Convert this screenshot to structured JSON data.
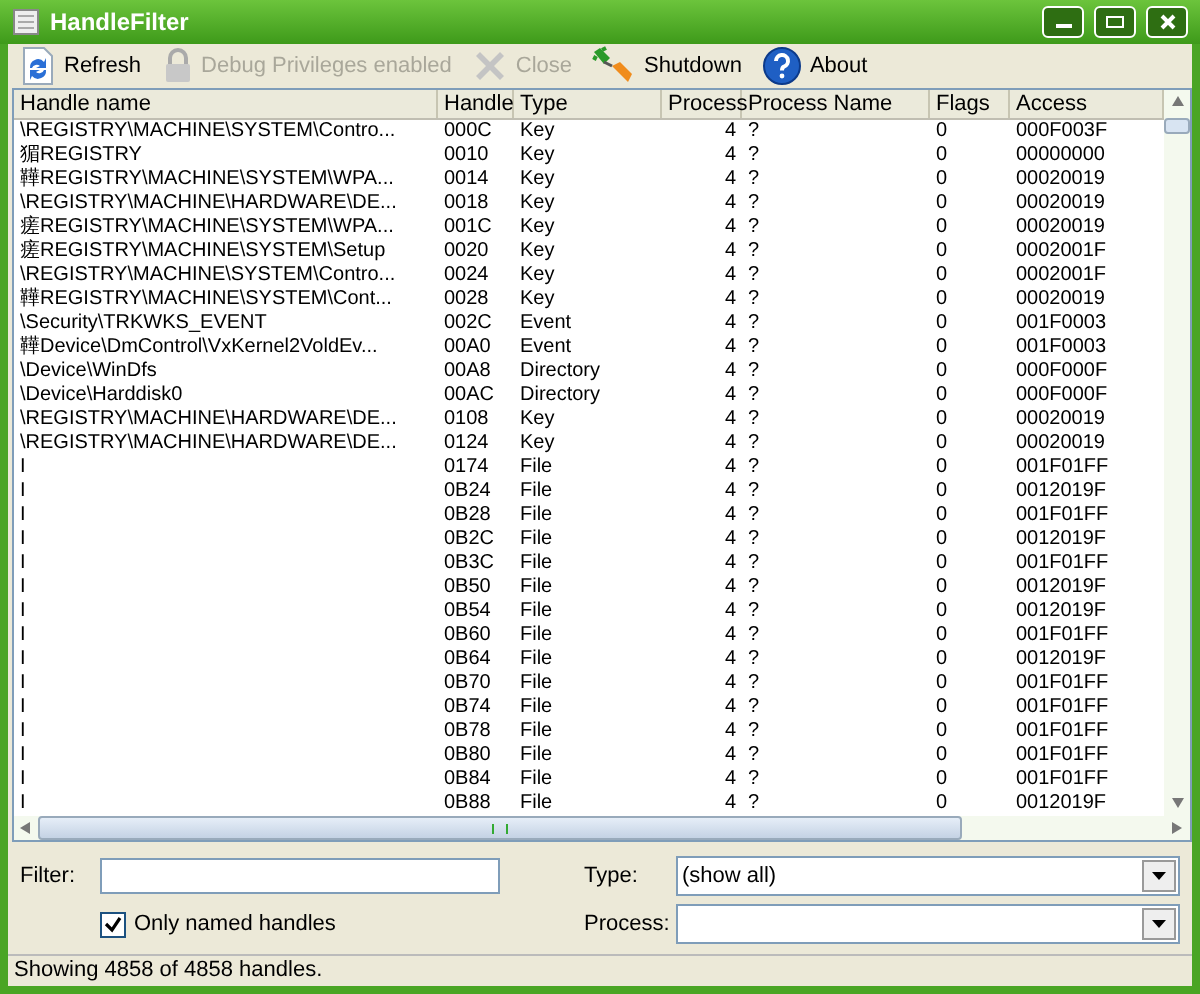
{
  "window": {
    "title": "HandleFilter"
  },
  "toolbar": [
    {
      "kind": "refresh",
      "label": "Refresh",
      "disabled": false
    },
    {
      "kind": "lock",
      "label": "Debug Privileges enabled",
      "disabled": true
    },
    {
      "kind": "close",
      "label": "Close",
      "disabled": true
    },
    {
      "kind": "shutdown",
      "label": "Shutdown",
      "disabled": false
    },
    {
      "kind": "about",
      "label": "About",
      "disabled": false
    }
  ],
  "table": {
    "columns": [
      "Handle name",
      "Handle",
      "Type",
      "Process",
      "Process Name",
      "Flags",
      "Access"
    ],
    "rows": [
      [
        "\\REGISTRY\\MACHINE\\SYSTEM\\Contro...",
        "000C",
        "Key",
        "4",
        "?",
        "0",
        "000F003F"
      ],
      [
        "猸REGISTRY",
        "0010",
        "Key",
        "4",
        "?",
        "0",
        "00000000"
      ],
      [
        "鞾REGISTRY\\MACHINE\\SYSTEM\\WPA...",
        "0014",
        "Key",
        "4",
        "?",
        "0",
        "00020019"
      ],
      [
        "\\REGISTRY\\MACHINE\\HARDWARE\\DE...",
        "0018",
        "Key",
        "4",
        "?",
        "0",
        "00020019"
      ],
      [
        "瘥REGISTRY\\MACHINE\\SYSTEM\\WPA...",
        "001C",
        "Key",
        "4",
        "?",
        "0",
        "00020019"
      ],
      [
        "瘥REGISTRY\\MACHINE\\SYSTEM\\Setup",
        "0020",
        "Key",
        "4",
        "?",
        "0",
        "0002001F"
      ],
      [
        "\\REGISTRY\\MACHINE\\SYSTEM\\Contro...",
        "0024",
        "Key",
        "4",
        "?",
        "0",
        "0002001F"
      ],
      [
        "鞾REGISTRY\\MACHINE\\SYSTEM\\Cont...",
        "0028",
        "Key",
        "4",
        "?",
        "0",
        "00020019"
      ],
      [
        "\\Security\\TRKWKS_EVENT",
        "002C",
        "Event",
        "4",
        "?",
        "0",
        "001F0003"
      ],
      [
        "鞾Device\\DmControl\\VxKernel2VoldEv...",
        "00A0",
        "Event",
        "4",
        "?",
        "0",
        "001F0003"
      ],
      [
        "\\Device\\WinDfs",
        "00A8",
        "Directory",
        "4",
        "?",
        "0",
        "000F000F"
      ],
      [
        "\\Device\\Harddisk0",
        "00AC",
        "Directory",
        "4",
        "?",
        "0",
        "000F000F"
      ],
      [
        "\\REGISTRY\\MACHINE\\HARDWARE\\DE...",
        "0108",
        "Key",
        "4",
        "?",
        "0",
        "00020019"
      ],
      [
        "\\REGISTRY\\MACHINE\\HARDWARE\\DE...",
        "0124",
        "Key",
        "4",
        "?",
        "0",
        "00020019"
      ],
      [
        "I",
        "0174",
        "File",
        "4",
        "?",
        "0",
        "001F01FF"
      ],
      [
        "I",
        "0B24",
        "File",
        "4",
        "?",
        "0",
        "0012019F"
      ],
      [
        "I",
        "0B28",
        "File",
        "4",
        "?",
        "0",
        "001F01FF"
      ],
      [
        "I",
        "0B2C",
        "File",
        "4",
        "?",
        "0",
        "0012019F"
      ],
      [
        "I",
        "0B3C",
        "File",
        "4",
        "?",
        "0",
        "001F01FF"
      ],
      [
        "I",
        "0B50",
        "File",
        "4",
        "?",
        "0",
        "0012019F"
      ],
      [
        "I",
        "0B54",
        "File",
        "4",
        "?",
        "0",
        "0012019F"
      ],
      [
        "I",
        "0B60",
        "File",
        "4",
        "?",
        "0",
        "001F01FF"
      ],
      [
        "I",
        "0B64",
        "File",
        "4",
        "?",
        "0",
        "0012019F"
      ],
      [
        "I",
        "0B70",
        "File",
        "4",
        "?",
        "0",
        "001F01FF"
      ],
      [
        "I",
        "0B74",
        "File",
        "4",
        "?",
        "0",
        "001F01FF"
      ],
      [
        "I",
        "0B78",
        "File",
        "4",
        "?",
        "0",
        "001F01FF"
      ],
      [
        "I",
        "0B80",
        "File",
        "4",
        "?",
        "0",
        "001F01FF"
      ],
      [
        "I",
        "0B84",
        "File",
        "4",
        "?",
        "0",
        "001F01FF"
      ],
      [
        "I",
        "0B88",
        "File",
        "4",
        "?",
        "0",
        "0012019F"
      ]
    ]
  },
  "filters": {
    "filter": {
      "label": "Filter:"
    },
    "only_named": {
      "label": "Only named handles",
      "checked": true
    },
    "type": {
      "label": "Type:",
      "value": "(show all)"
    },
    "process": {
      "label": "Process:"
    }
  },
  "status_bar": "Showing 4858 of 4858 handles."
}
